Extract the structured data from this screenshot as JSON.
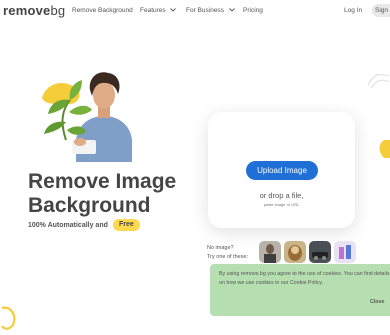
{
  "nav": {
    "logo_main": "remove",
    "logo_suffix": "bg",
    "links": [
      "Remove Background",
      "Features",
      "For Business",
      "Pricing"
    ],
    "login": "Log In",
    "signup": "Sign"
  },
  "hero": {
    "title_line1": "Remove Image",
    "title_line2": "Background",
    "subtitle": "100% Automatically and",
    "free_badge": "Free"
  },
  "upload": {
    "button": "Upload Image",
    "drop_text": "or drop a file,",
    "paste_text": "paste image or URL"
  },
  "samples": {
    "line1": "No image?",
    "line2": "Try one of these:"
  },
  "cookie": {
    "text": "By using remove.bg you agree to the use of cookies. You can find details on how we use cookies in our Cookie Policy.",
    "close": "Close"
  },
  "colors": {
    "accent": "#1f6fd6",
    "free_badge": "#ffd84d",
    "cookie_bg": "#b6dfb1",
    "deco_yellow": "#f5cc3a"
  }
}
